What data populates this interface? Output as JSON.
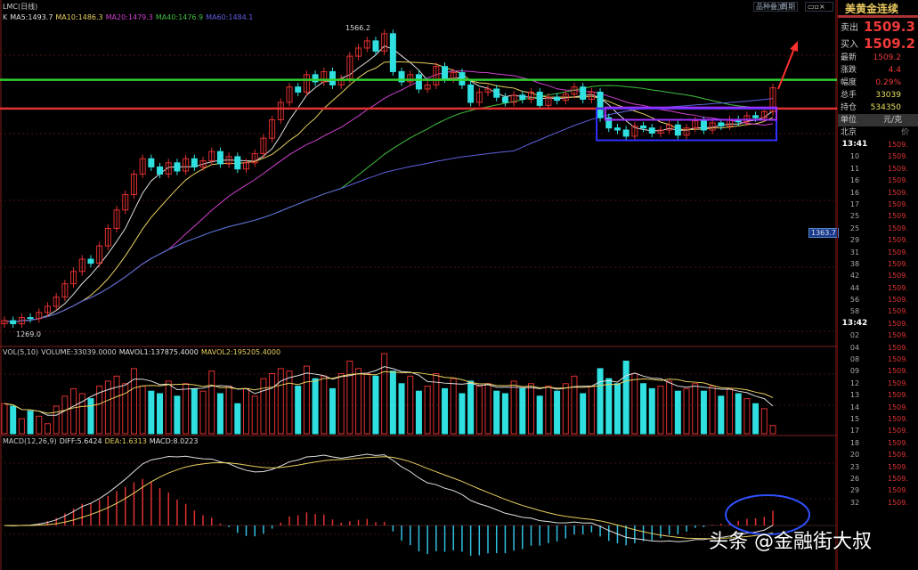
{
  "header": {
    "title": "LMC(日线)",
    "buttons": [
      "品种叠加",
      "周期"
    ],
    "window_controls": [
      "minimize-icon",
      "restore-icon",
      "close-icon"
    ]
  },
  "legends": {
    "main": [
      {
        "text": "K",
        "color": "#cccccc"
      },
      {
        "text": "MA5:1493.7",
        "color": "#e0e0e0"
      },
      {
        "text": "MA10:1486.3",
        "color": "#e8d060"
      },
      {
        "text": "MA20:1479.3",
        "color": "#d040d0"
      },
      {
        "text": "MA40:1476.9",
        "color": "#40c040"
      },
      {
        "text": "MA60:1484.1",
        "color": "#6060e0"
      }
    ],
    "vol": [
      {
        "text": "VOL(5,10)",
        "color": "#cccccc"
      },
      {
        "text": "VOLUME:33039.0000",
        "color": "#cccccc"
      },
      {
        "text": "MAVOL1:137875.4000",
        "color": "#e0e0e0"
      },
      {
        "text": "MAVOL2:195205.4000",
        "color": "#e8d060"
      }
    ],
    "macd": [
      {
        "text": "MACD(12,26,9)",
        "color": "#cccccc"
      },
      {
        "text": "DIFF:5.6424",
        "color": "#e0e0e0"
      },
      {
        "text": "DEA:1.6313",
        "color": "#e8d060"
      },
      {
        "text": "MACD:8.0223",
        "color": "#e0e0e0"
      }
    ]
  },
  "chart_data": {
    "type": "candlestick",
    "ylim": [
      1269,
      1566.2
    ],
    "extremes": {
      "high": "1566.2",
      "low": "1269.0"
    },
    "price_label": "1363.7",
    "close": [
      1282,
      1279,
      1285,
      1284,
      1290,
      1296,
      1305,
      1318,
      1330,
      1342,
      1338,
      1355,
      1372,
      1390,
      1405,
      1425,
      1440,
      1432,
      1425,
      1436,
      1428,
      1440,
      1432,
      1438,
      1447,
      1435,
      1442,
      1430,
      1436,
      1445,
      1460,
      1478,
      1495,
      1510,
      1505,
      1522,
      1515,
      1525,
      1512,
      1518,
      1540,
      1548,
      1555,
      1545,
      1562,
      1525,
      1515,
      1522,
      1508,
      1512,
      1530,
      1518,
      1524,
      1512,
      1495,
      1505,
      1508,
      1500,
      1495,
      1502,
      1498,
      1505,
      1492,
      1500,
      1497,
      1503,
      1510,
      1498,
      1505,
      1480,
      1470,
      1468,
      1462,
      1472,
      1470,
      1465,
      1468,
      1473,
      1463,
      1470,
      1477,
      1468,
      1475,
      1472,
      1478,
      1476,
      1482,
      1480,
      1486,
      1509.2
    ],
    "volume": [
      120000,
      110000,
      60000,
      90000,
      70000,
      40000,
      110000,
      150000,
      180000,
      160000,
      140000,
      190000,
      210000,
      230000,
      200000,
      260000,
      190000,
      170000,
      160000,
      210000,
      150000,
      200000,
      180000,
      170000,
      250000,
      160000,
      190000,
      120000,
      180000,
      150000,
      220000,
      240000,
      260000,
      250000,
      190000,
      270000,
      220000,
      230000,
      180000,
      240000,
      290000,
      260000,
      240000,
      230000,
      320000,
      250000,
      200000,
      230000,
      170000,
      190000,
      240000,
      180000,
      220000,
      160000,
      210000,
      190000,
      200000,
      170000,
      160000,
      210000,
      180000,
      200000,
      150000,
      190000,
      170000,
      200000,
      230000,
      160000,
      190000,
      260000,
      220000,
      200000,
      290000,
      240000,
      200000,
      180000,
      190000,
      210000,
      170000,
      180000,
      200000,
      170000,
      190000,
      150000,
      180000,
      160000,
      140000,
      120000,
      100000,
      33039
    ],
    "support_lines": [
      {
        "price": 1517,
        "color": "#30d030"
      },
      {
        "price": 1489,
        "color": "#e03030"
      }
    ],
    "boxes": [
      {
        "from_index": 69,
        "to_index": 89,
        "top": 1489,
        "bottom": 1458,
        "color": "#3030ff"
      },
      {
        "from_index": 70,
        "to_index": 89,
        "top": 1490,
        "bottom": 1478,
        "color": "#a030ff"
      }
    ],
    "colors": {
      "up": "#e03030",
      "down": "#30e0e0"
    }
  },
  "quote": {
    "title": "美黄金连续",
    "sell": {
      "label": "卖出",
      "value": "1509.3"
    },
    "buy": {
      "label": "买入",
      "value": "1509.2"
    },
    "stats": [
      {
        "label": "最新",
        "value": "1509.2",
        "color": "#f03a3a"
      },
      {
        "label": "涨跌",
        "value": "4.4",
        "color": "#f03a3a"
      },
      {
        "label": "幅度",
        "value": "0.29%",
        "color": "#f03a3a"
      },
      {
        "label": "总手",
        "value": "33039",
        "color": "#e8e060"
      },
      {
        "label": "持仓",
        "value": "534350",
        "color": "#e8e060"
      }
    ],
    "unit": {
      "label": "单位",
      "value": "元/克"
    },
    "ticks_header": {
      "label": "北京",
      "value": "价"
    },
    "ticks": [
      {
        "t": "13:41",
        "b": true
      },
      {
        "t": "10"
      },
      {
        "t": "11"
      },
      {
        "t": "16"
      },
      {
        "t": "16"
      },
      {
        "t": "17"
      },
      {
        "t": "25"
      },
      {
        "t": "25"
      },
      {
        "t": "29"
      },
      {
        "t": "31"
      },
      {
        "t": "38"
      },
      {
        "t": "42"
      },
      {
        "t": "44"
      },
      {
        "t": "56"
      },
      {
        "t": "58"
      },
      {
        "t": "13:42",
        "b": true
      },
      {
        "t": "02"
      },
      {
        "t": "04"
      },
      {
        "t": "08"
      },
      {
        "t": "09"
      },
      {
        "t": "12"
      },
      {
        "t": "13"
      },
      {
        "t": "14"
      },
      {
        "t": "15"
      },
      {
        "t": "17"
      },
      {
        "t": "18"
      },
      {
        "t": "20"
      },
      {
        "t": "23"
      },
      {
        "t": "26"
      },
      {
        "t": "29"
      },
      {
        "t": "32"
      }
    ],
    "tick_price": "1509."
  },
  "watermark": "头条 @金融街大叔"
}
